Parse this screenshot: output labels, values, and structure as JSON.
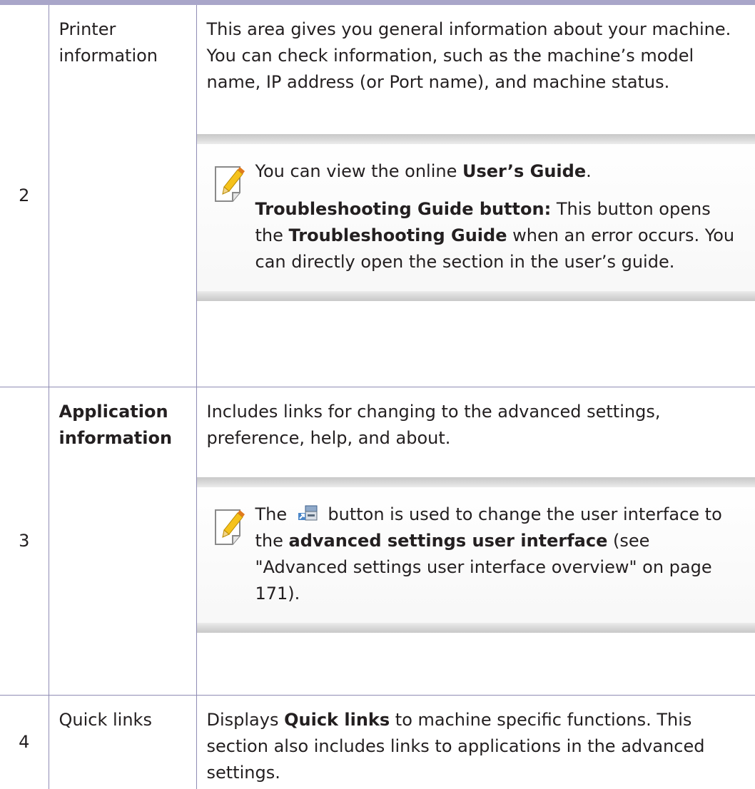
{
  "rows": [
    {
      "number": "2",
      "label": "Printer information",
      "description": "This area gives you general information about your machine. You can check information, such as the machine’s model name, IP address (or Port name), and machine status.",
      "note": {
        "icon": "note-pencil-icon",
        "p1_prefix": "You can view the online ",
        "p1_bold": "User’s Guide",
        "p1_suffix": ".",
        "p2_bold1": "Troubleshooting Guide  button:",
        "p2_text1": " This button opens the ",
        "p2_bold2": "Troubleshooting Guide",
        "p2_text2": " when an error occurs. You can directly open the section in the user’s guide."
      }
    },
    {
      "number": "3",
      "label": "Application information",
      "description": "Includes links for changing to the advanced settings, preference, help, and about.",
      "note": {
        "icon": "note-pencil-icon",
        "text_prefix": "The ",
        "button_icon": "advanced-settings-switch-icon",
        "text_middle": " button is used to change the user interface to the ",
        "text_bold": "advanced settings user interface",
        "text_suffix": " (see \"Advanced settings user interface overview\" on page 171)."
      }
    },
    {
      "number": "4",
      "label": "Quick links",
      "desc_prefix": "Displays ",
      "desc_bold": "Quick links",
      "desc_suffix": " to machine specific functions. This section also includes links to applications in the advanced settings."
    }
  ],
  "colors": {
    "rule": "#a9a6c9",
    "border": "#8f8cb4",
    "text": "#231f20"
  }
}
